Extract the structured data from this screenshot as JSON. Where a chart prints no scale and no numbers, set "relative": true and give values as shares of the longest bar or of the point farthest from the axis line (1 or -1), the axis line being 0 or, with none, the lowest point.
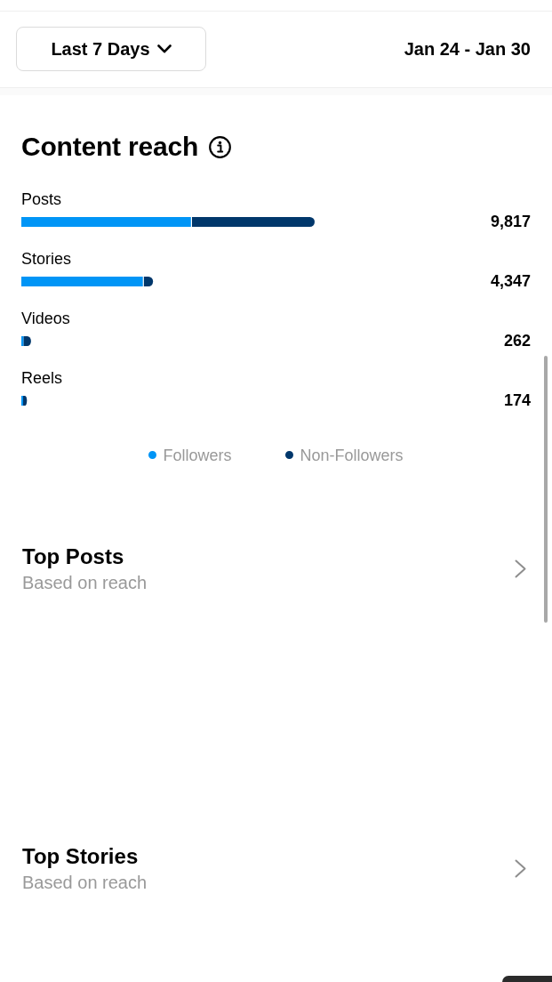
{
  "header": {
    "range_dropdown": {
      "label": "Last 7 Days"
    },
    "date_range": "Jan 24 - Jan 30"
  },
  "content_reach": {
    "title": "Content reach",
    "chart_data": {
      "type": "bar",
      "orientation": "horizontal",
      "stacked": true,
      "relative": true,
      "legend": "bottom",
      "categories": [
        "Posts",
        "Stories",
        "Videos",
        "Reels"
      ],
      "series": [
        {
          "name": "Followers",
          "color": "#0095f6",
          "values": [
            0.58,
            0.416,
            0.008,
            0.006
          ]
        },
        {
          "name": "Non-Followers",
          "color": "#00376b",
          "values": [
            0.42,
            0.033,
            0.025,
            0.013
          ]
        }
      ],
      "value_labels": [
        "9,817",
        "4,347",
        "262",
        "174"
      ]
    }
  },
  "sections": [
    {
      "title": "Top Posts",
      "subtitle": "Based on reach"
    },
    {
      "title": "Top Stories",
      "subtitle": "Based on reach"
    }
  ]
}
